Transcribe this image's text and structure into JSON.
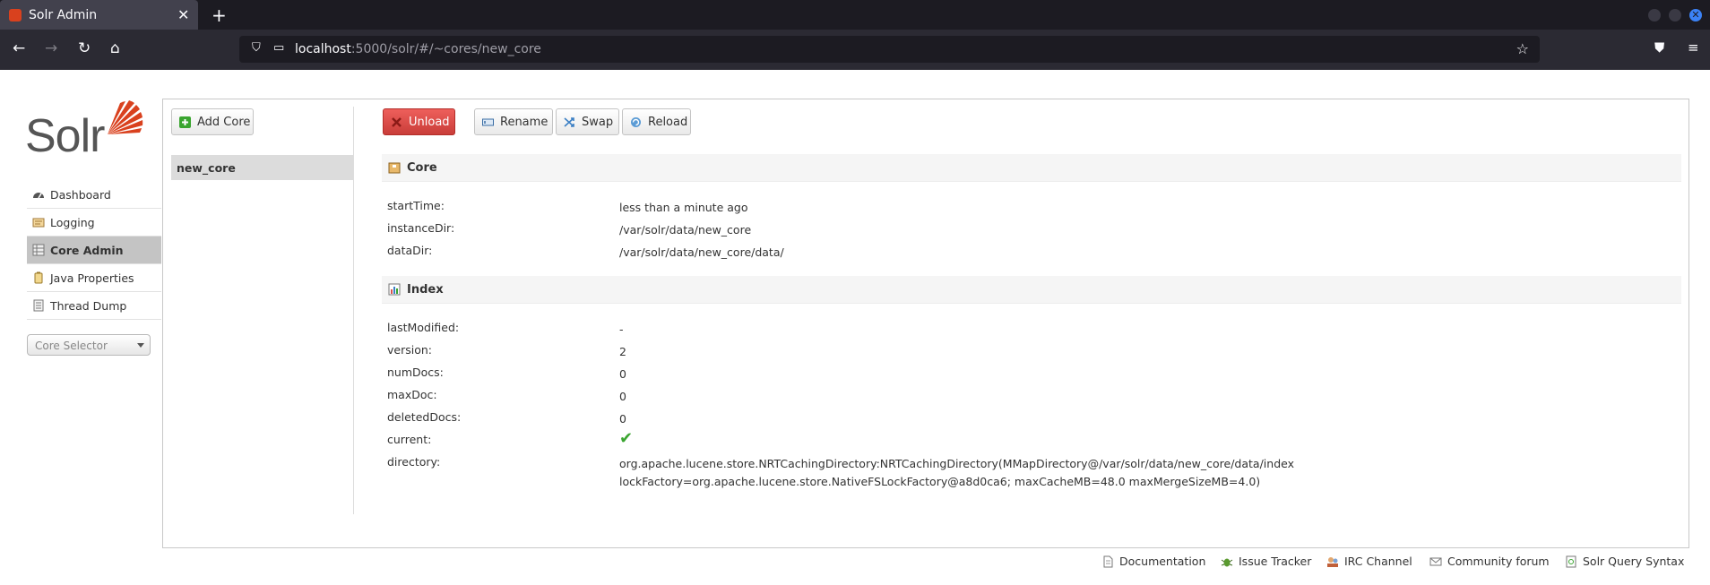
{
  "browser": {
    "tab_title": "Solr Admin",
    "tab_close": "✕",
    "new_tab": "+",
    "url_host": "localhost",
    "url_path": ":5000/solr/#/~cores/new_core"
  },
  "logo": {
    "text": "Solr"
  },
  "sidebar": {
    "items": [
      {
        "label": "Dashboard",
        "icon": "dashboard-icon"
      },
      {
        "label": "Logging",
        "icon": "logging-icon"
      },
      {
        "label": "Core Admin",
        "icon": "core-admin-icon",
        "active": true
      },
      {
        "label": "Java Properties",
        "icon": "java-properties-icon"
      },
      {
        "label": "Thread Dump",
        "icon": "thread-dump-icon"
      }
    ],
    "core_selector_placeholder": "Core Selector"
  },
  "actions": {
    "add_core": "Add Core",
    "unload": "Unload",
    "rename": "Rename",
    "swap": "Swap",
    "reload": "Reload"
  },
  "cores": [
    "new_core"
  ],
  "core_section": {
    "title": "Core",
    "rows": [
      {
        "key": "startTime:",
        "value": "less than a minute ago"
      },
      {
        "key": "instanceDir:",
        "value": "/var/solr/data/new_core"
      },
      {
        "key": "dataDir:",
        "value": "/var/solr/data/new_core/data/"
      }
    ]
  },
  "index_section": {
    "title": "Index",
    "rows": [
      {
        "key": "lastModified:",
        "value": "-"
      },
      {
        "key": "version:",
        "value": "2"
      },
      {
        "key": "numDocs:",
        "value": "0"
      },
      {
        "key": "maxDoc:",
        "value": "0"
      },
      {
        "key": "deletedDocs:",
        "value": "0"
      },
      {
        "key": "current:",
        "value": "✔"
      },
      {
        "key": "directory:",
        "value": "org.apache.lucene.store.NRTCachingDirectory:NRTCachingDirectory(MMapDirectory@/var/solr/data/new_core/data/index lockFactory=org.apache.lucene.store.NativeFSLockFactory@a8d0ca6; maxCacheMB=48.0 maxMergeSizeMB=4.0)"
      }
    ]
  },
  "footer": {
    "links": [
      {
        "label": "Documentation",
        "icon": "documentation-icon"
      },
      {
        "label": "Issue Tracker",
        "icon": "bug-icon"
      },
      {
        "label": "IRC Channel",
        "icon": "irc-icon"
      },
      {
        "label": "Community forum",
        "icon": "mail-icon"
      },
      {
        "label": "Solr Query Syntax",
        "icon": "query-syntax-icon"
      }
    ]
  },
  "colors": {
    "brand": "#d9411e",
    "danger": "#d9534f",
    "check": "#3aa530"
  }
}
